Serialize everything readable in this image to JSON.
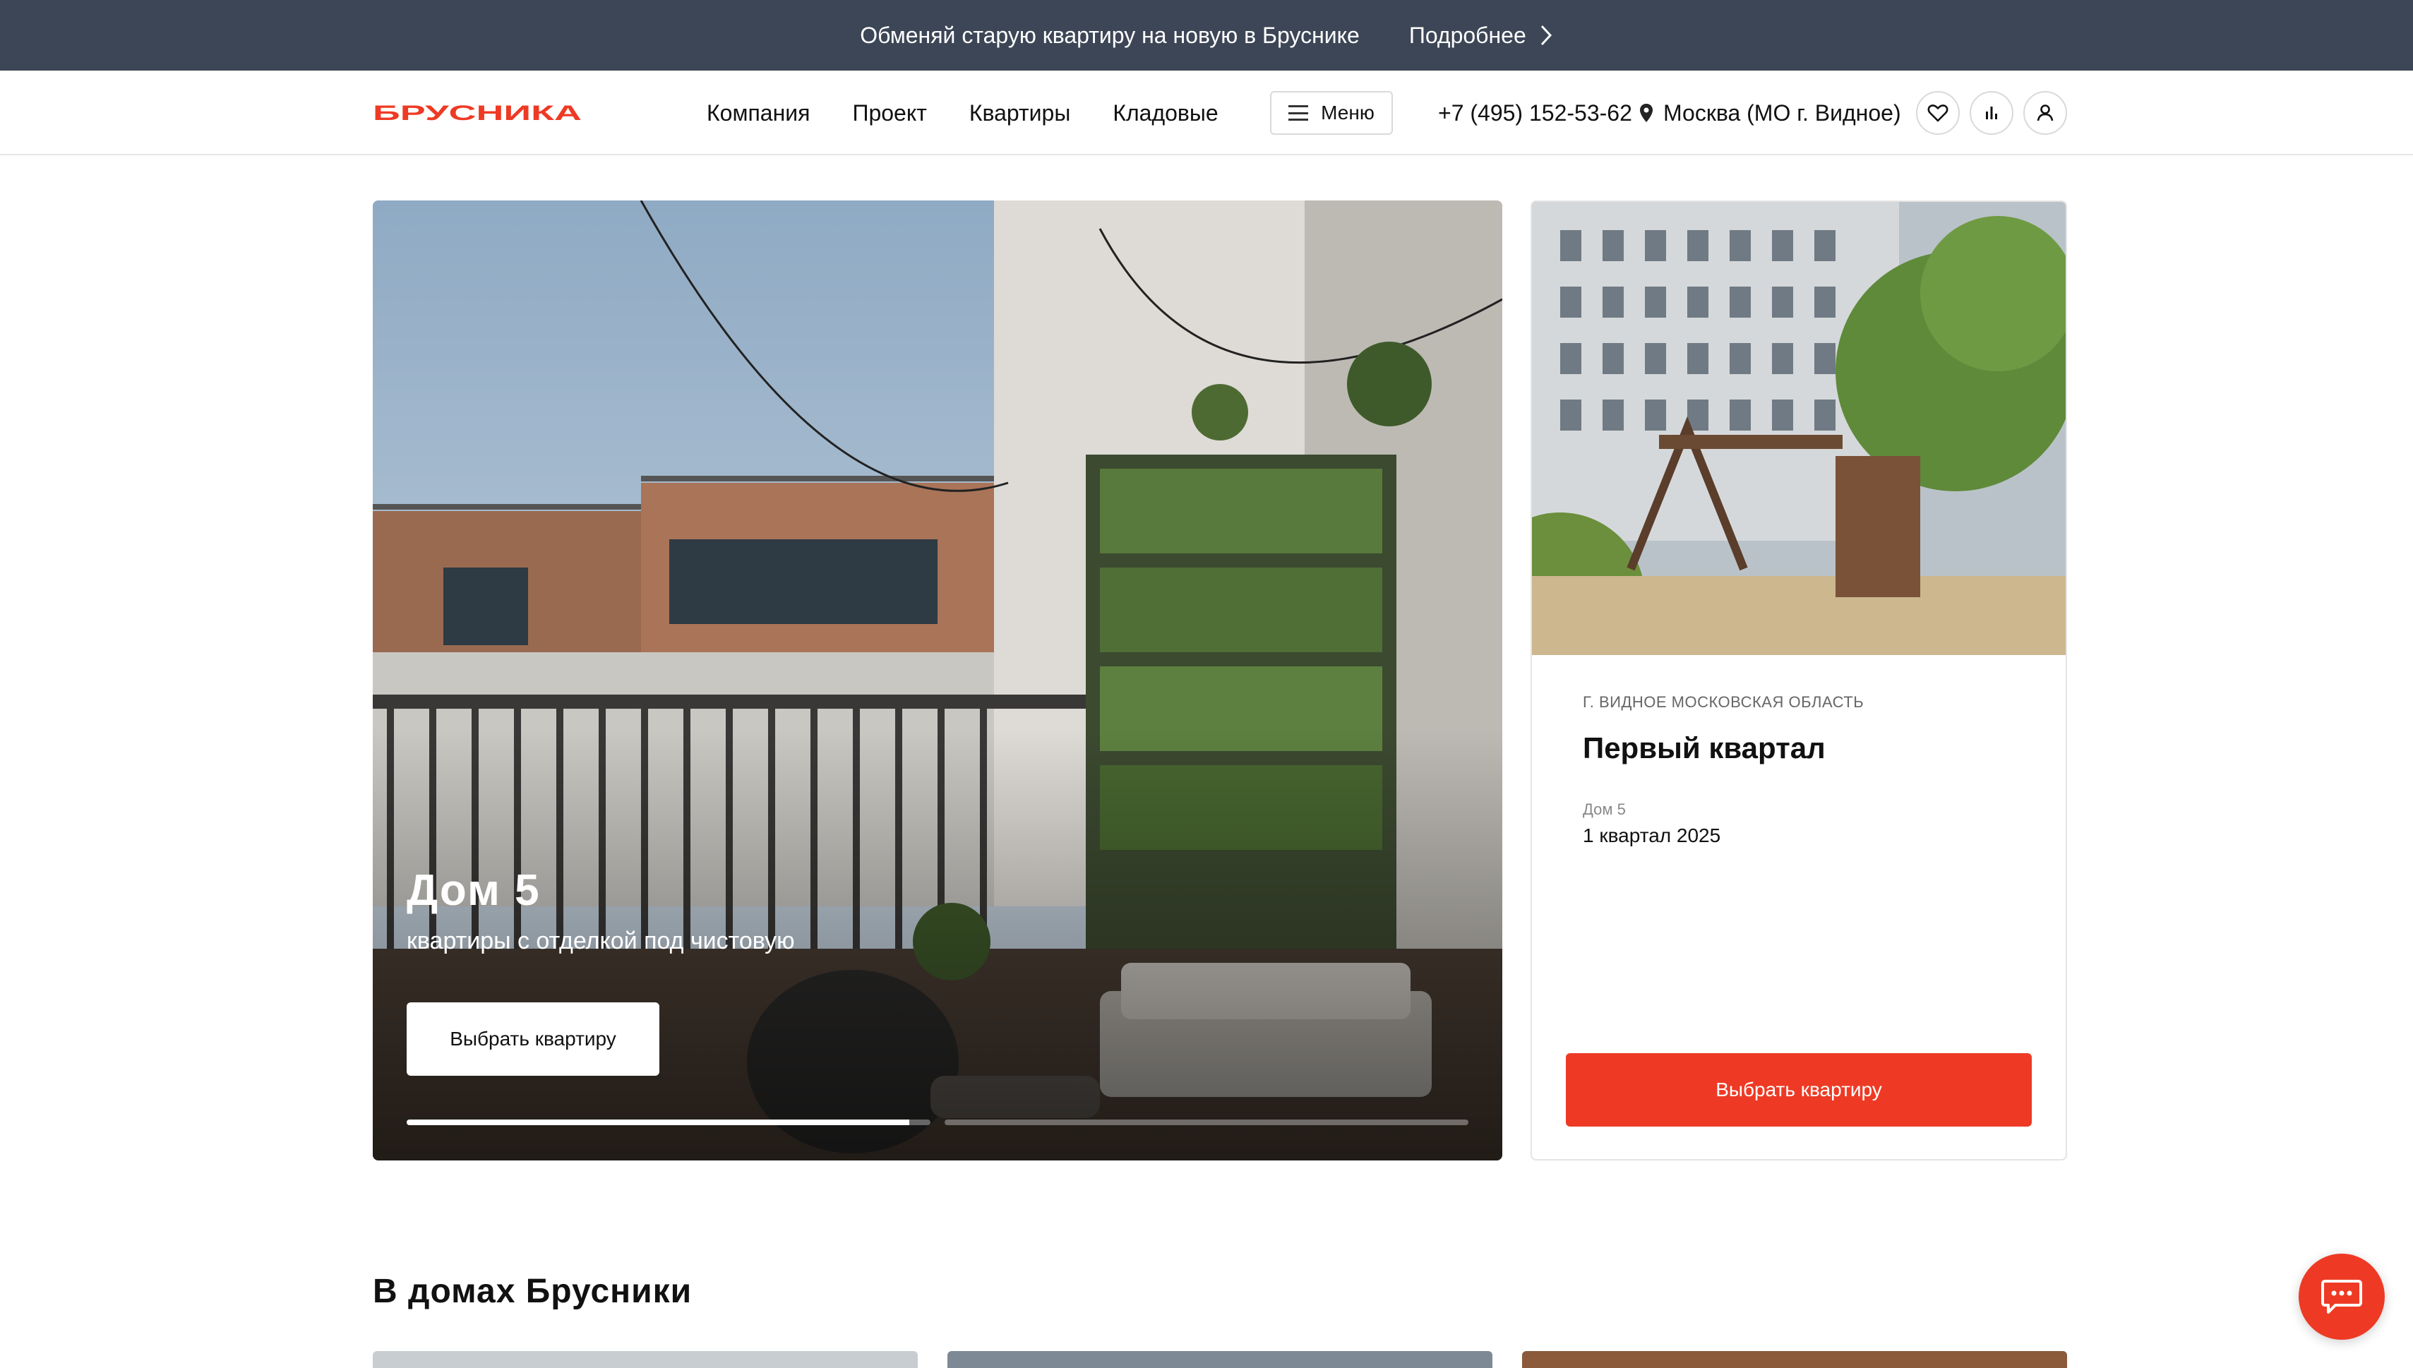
{
  "promo": {
    "text": "Обменяй старую квартиру на новую в Бруснике",
    "more_label": "Подробнее"
  },
  "header": {
    "logo_text": "БРУСНИКА",
    "nav": [
      "Компания",
      "Проект",
      "Квартиры",
      "Кладовые"
    ],
    "menu_label": "Меню",
    "phone": "+7 (495) 152-53-62",
    "location": "Москва (МО г. Видное)"
  },
  "hero": {
    "title": "Дом 5",
    "subtitle": "квартиры с отделкой под чистовую",
    "button_label": "Выбрать квартиру",
    "slides_total": 2,
    "active_slide_progress": 0.96
  },
  "card": {
    "region": "г. Видное Московская область",
    "title": "Первый квартал",
    "house_label": "Дом 5",
    "house_date": "1 квартал 2025",
    "button_label": "Выбрать квартиру"
  },
  "section": {
    "title": "В домах Брусники"
  },
  "colors": {
    "brand_red": "#ee3a24",
    "promo_bg": "#3c4656"
  },
  "icons": [
    "chevron-right-icon",
    "menu-icon",
    "location-pin-icon",
    "heart-icon",
    "chart-icon",
    "user-icon",
    "chat-icon"
  ]
}
